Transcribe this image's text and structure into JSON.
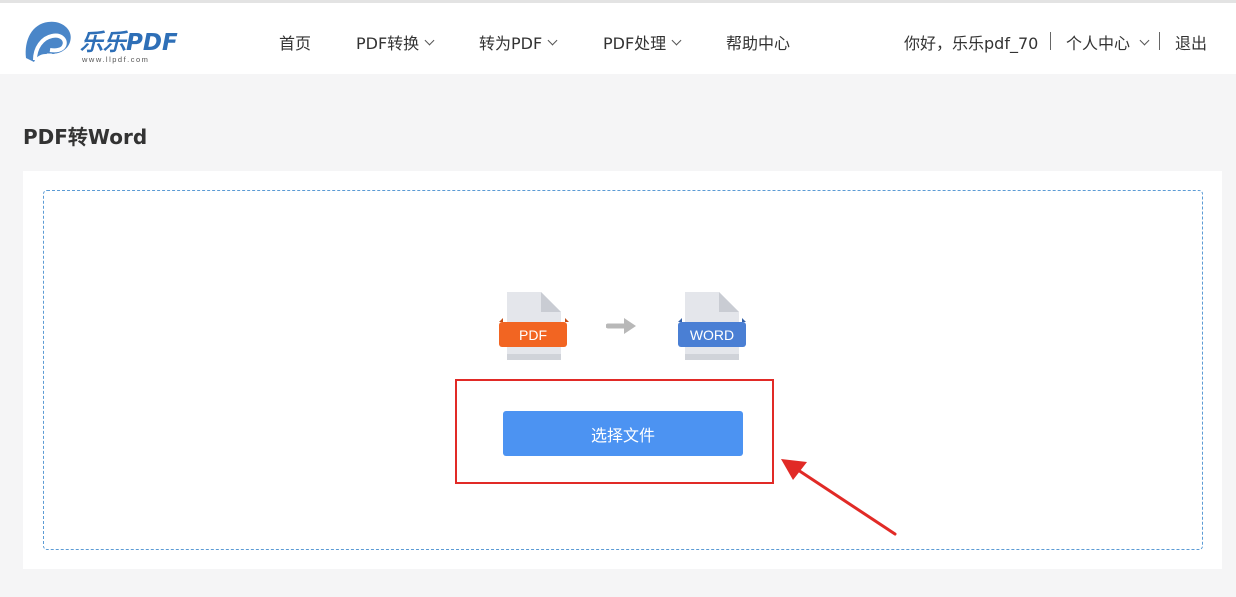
{
  "header": {
    "logo_text": "乐乐PDF",
    "logo_url_text": "www.llpdf.com",
    "nav": [
      {
        "label": "首页",
        "dropdown": false
      },
      {
        "label": "PDF转换",
        "dropdown": true
      },
      {
        "label": "转为PDF",
        "dropdown": true
      },
      {
        "label": "PDF处理",
        "dropdown": true
      },
      {
        "label": "帮助中心",
        "dropdown": false
      }
    ],
    "greeting": "你好，乐乐pdf_70",
    "user_center": "个人中心",
    "logout": "退出"
  },
  "main": {
    "page_title": "PDF转Word",
    "source_badge": "PDF",
    "target_badge": "WORD",
    "choose_file_label": "选择文件"
  },
  "colors": {
    "accent": "#4c93f2",
    "pdf_badge": "#f26522",
    "word_badge": "#4a7fd4",
    "annotation_red": "#e12a26"
  }
}
